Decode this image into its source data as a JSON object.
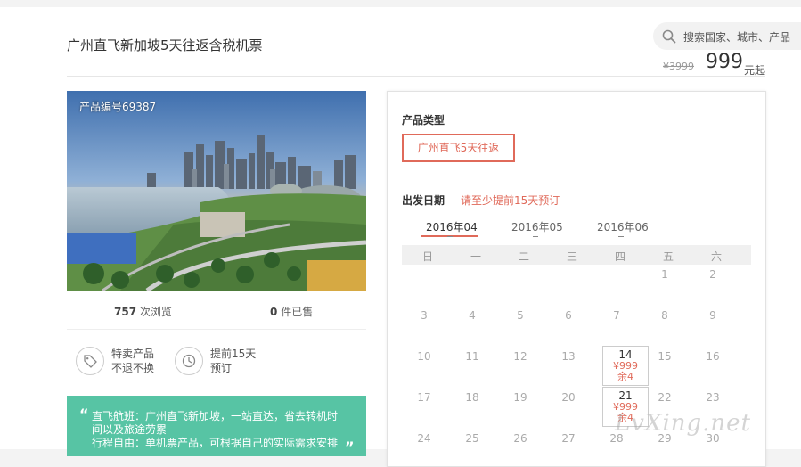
{
  "header": {
    "title": "广州直飞新加坡5天往返含税机票",
    "search_placeholder": "搜索国家、城市、产品",
    "price_old": "¥3999",
    "price_now": "999",
    "price_suffix": "元起"
  },
  "product": {
    "code_label": "产品编号69387",
    "views_count": "757",
    "views_label": "次浏览",
    "sold_count": "0",
    "sold_label": "件已售",
    "features": [
      {
        "line1": "特卖产品",
        "line2": "不退不换",
        "icon": "tag-icon"
      },
      {
        "line1": "提前15天",
        "line2": "预订",
        "icon": "clock-icon"
      }
    ],
    "quote": {
      "open": "“",
      "line1": "直飞航班：广州直飞新加坡，一站直达，省去转机时",
      "line2": "间以及旅途劳累",
      "line3": "行程自由：单机票产品，可根据自己的实际需求安排",
      "close": "”"
    }
  },
  "booking": {
    "type_label": "产品类型",
    "type_option": "广州直飞5天往返",
    "date_label": "出发日期",
    "date_hint": "请至少提前15天预订",
    "months": [
      "2016年04",
      "2016年05",
      "2016年06"
    ],
    "weekdays": [
      "日",
      "一",
      "二",
      "三",
      "四",
      "五",
      "六"
    ],
    "rows": [
      [
        "",
        "",
        "",
        "",
        "",
        "1",
        "2"
      ],
      [
        "3",
        "4",
        "5",
        "6",
        "7",
        "8",
        "9"
      ],
      [
        "10",
        "11",
        "12",
        "13",
        "14",
        "15",
        "16"
      ],
      [
        "17",
        "18",
        "19",
        "20",
        "21",
        "22",
        "23"
      ],
      [
        "24",
        "25",
        "26",
        "27",
        "28",
        "29",
        "30"
      ]
    ],
    "available": [
      {
        "day": "14",
        "price": "¥999",
        "remain": "余4"
      },
      {
        "day": "21",
        "price": "¥999",
        "remain": "余4"
      }
    ]
  },
  "watermark": "LvXing.net",
  "colors": {
    "accent": "#e06a5a",
    "quote_bg": "#57c4a4"
  }
}
